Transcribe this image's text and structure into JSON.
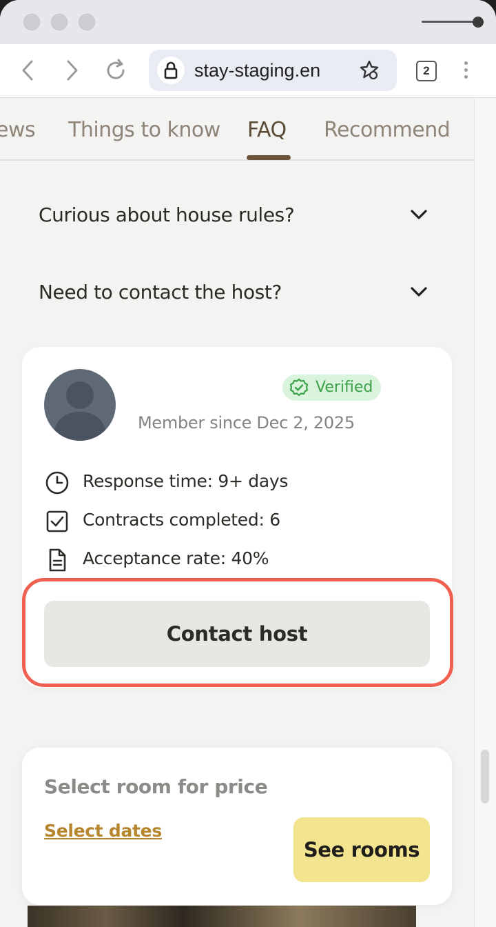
{
  "browser": {
    "url": "stay-staging.en",
    "tab_count": "2"
  },
  "tabs": [
    {
      "label": "ews"
    },
    {
      "label": "Things to know"
    },
    {
      "label": "FAQ"
    },
    {
      "label": "Recommend"
    }
  ],
  "faq": [
    {
      "question": "Curious about house rules?"
    },
    {
      "question": "Need to contact the host?"
    }
  ],
  "host": {
    "verified_label": "Verified",
    "member_since": "Member since Dec 2, 2025",
    "stats": [
      {
        "icon": "clock-icon",
        "text": "Response time: 9+ days"
      },
      {
        "icon": "checkbox-icon",
        "text": "Contracts completed: 6"
      },
      {
        "icon": "document-icon",
        "text": "Acceptance rate: 40%"
      }
    ],
    "contact_label": "Contact host"
  },
  "pricing": {
    "title": "Select room for price",
    "select_dates": "Select dates",
    "see_rooms": "See rooms"
  },
  "colors": {
    "accent_brown": "#6b5538",
    "verified_green": "#3da24a",
    "highlight_red": "#f06050",
    "see_rooms_yellow": "#f3e590",
    "link_gold": "#b7852e"
  }
}
